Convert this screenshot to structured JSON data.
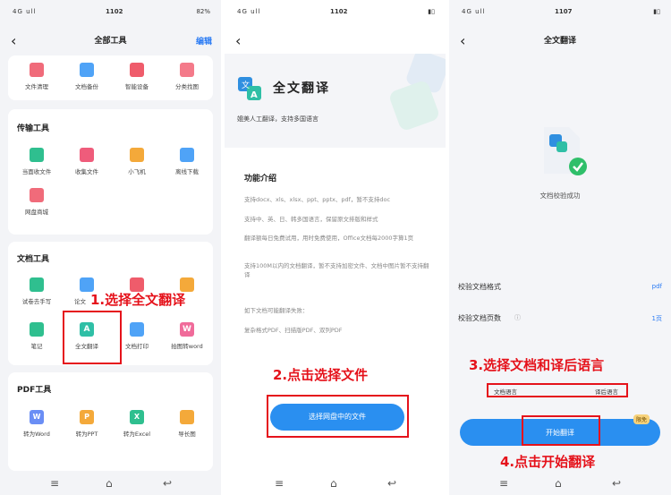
{
  "panel1": {
    "status_time": "1102",
    "status_signal": "4G ull",
    "status_right": "82%",
    "title": "全部工具",
    "action": "编辑",
    "top_tools": [
      {
        "label": "文件清理",
        "color": "#f06b7a"
      },
      {
        "label": "文档备份",
        "color": "#4fa3f7"
      },
      {
        "label": "智能设备",
        "color": "#ef5c6b"
      },
      {
        "label": "分类找图",
        "color": "#f47a8a"
      }
    ],
    "transfer": {
      "title": "传输工具",
      "tools": [
        {
          "label": "当面收文件",
          "color": "#2fbf8f"
        },
        {
          "label": "收集文件",
          "color": "#ef5c7b"
        },
        {
          "label": "小飞机",
          "color": "#f4a93a"
        },
        {
          "label": "离线下载",
          "color": "#4fa3f7"
        },
        {
          "label": "网盘商城",
          "color": "#f06b7a"
        }
      ]
    },
    "doc": {
      "title": "文档工具",
      "tools": [
        {
          "label": "试卷去手写",
          "color": "#2fbf8f"
        },
        {
          "label": "论文",
          "color": "#4fa3f7"
        },
        {
          "label": "",
          "color": "#ef5c6b"
        },
        {
          "label": "",
          "color": "#f4a93a"
        },
        {
          "label": "笔记",
          "color": "#2fbf8f"
        },
        {
          "label": "全文翻译",
          "color": "#2fbfa6"
        },
        {
          "label": "文档打印",
          "color": "#4fa3f7"
        },
        {
          "label": "拍图转word",
          "color": "#f06b9a"
        }
      ]
    },
    "pdf": {
      "title": "PDF工具",
      "tools": [
        {
          "label": "转为Word",
          "color": "#6a8ef5"
        },
        {
          "label": "转为PPT",
          "color": "#f4a93a"
        },
        {
          "label": "转为Excel",
          "color": "#2fbf8f"
        },
        {
          "label": "导长图",
          "color": "#f4a93a"
        }
      ]
    },
    "annotation": "1.选择全文翻译"
  },
  "panel2": {
    "status_time": "1102",
    "hero_title": "全文翻译",
    "hero_subtitle": "媲美人工翻译，支持多国语言",
    "features_title": "功能介绍",
    "features": [
      "支持docx、xls、xlsx、ppt、pptx、pdf，暂不支持doc",
      "支持中、英、日、韩多国语言，保留原文排版和样式",
      "翻译额每日免费试用，用时免费使用，Office文档每2000字算1页",
      "支持100M以内的文档翻译，暂不支持加密文件、文档中图片暂不支持翻译",
      "如下文档可能翻译失败：",
      "复杂格式PDF、扫描版PDF、双列PDF"
    ],
    "button": "选择网盘中的文件",
    "annotation": "2.点击选择文件"
  },
  "panel3": {
    "status_time": "1107",
    "title": "全文翻译",
    "success_text": "文档校验成功",
    "rows": [
      {
        "label": "校验文档格式",
        "value": "pdf"
      },
      {
        "label": "校验文档页数",
        "value": "1页"
      }
    ],
    "source_lang": "文档语言",
    "target_lang": "译后语言",
    "button": "开始翻译",
    "badge": "限免",
    "annotation3": "3.选择文档和译后语言",
    "annotation4": "4.点击开始翻译"
  },
  "colors": {
    "accent": "#2a8ff0",
    "annotation_red": "#e5121b"
  }
}
